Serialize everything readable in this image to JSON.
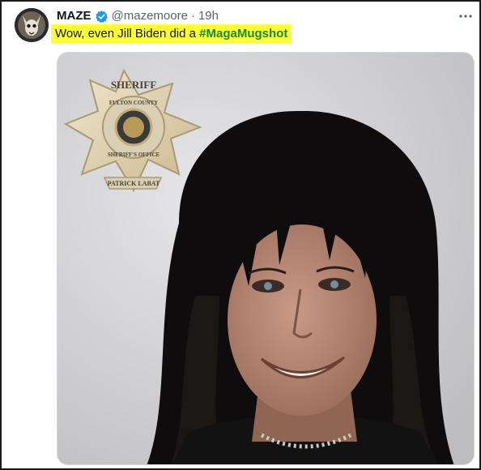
{
  "tweet": {
    "author": {
      "display_name": "MAZE",
      "handle": "@mazemoore",
      "separator": "·",
      "time": "19h",
      "verified": true
    },
    "text_prefix": "Wow, even Jill Biden did a ",
    "hashtag": "#MagaMugshot",
    "highlight_color": "#ffff3a",
    "hashtag_color": "#1a8a2a",
    "media": {
      "badge_top_arc": "SHERIFF",
      "badge_ring_top": "FULTON COUNTY",
      "badge_ring_bottom": "SHERIFF'S OFFICE",
      "badge_ribbon": "PATRICK LABAT"
    }
  },
  "icons": {
    "verified": "verified-badge-icon",
    "more": "more-options-icon"
  },
  "colors": {
    "verified_blue": "#1d9bf0",
    "muted_text": "#536471"
  }
}
